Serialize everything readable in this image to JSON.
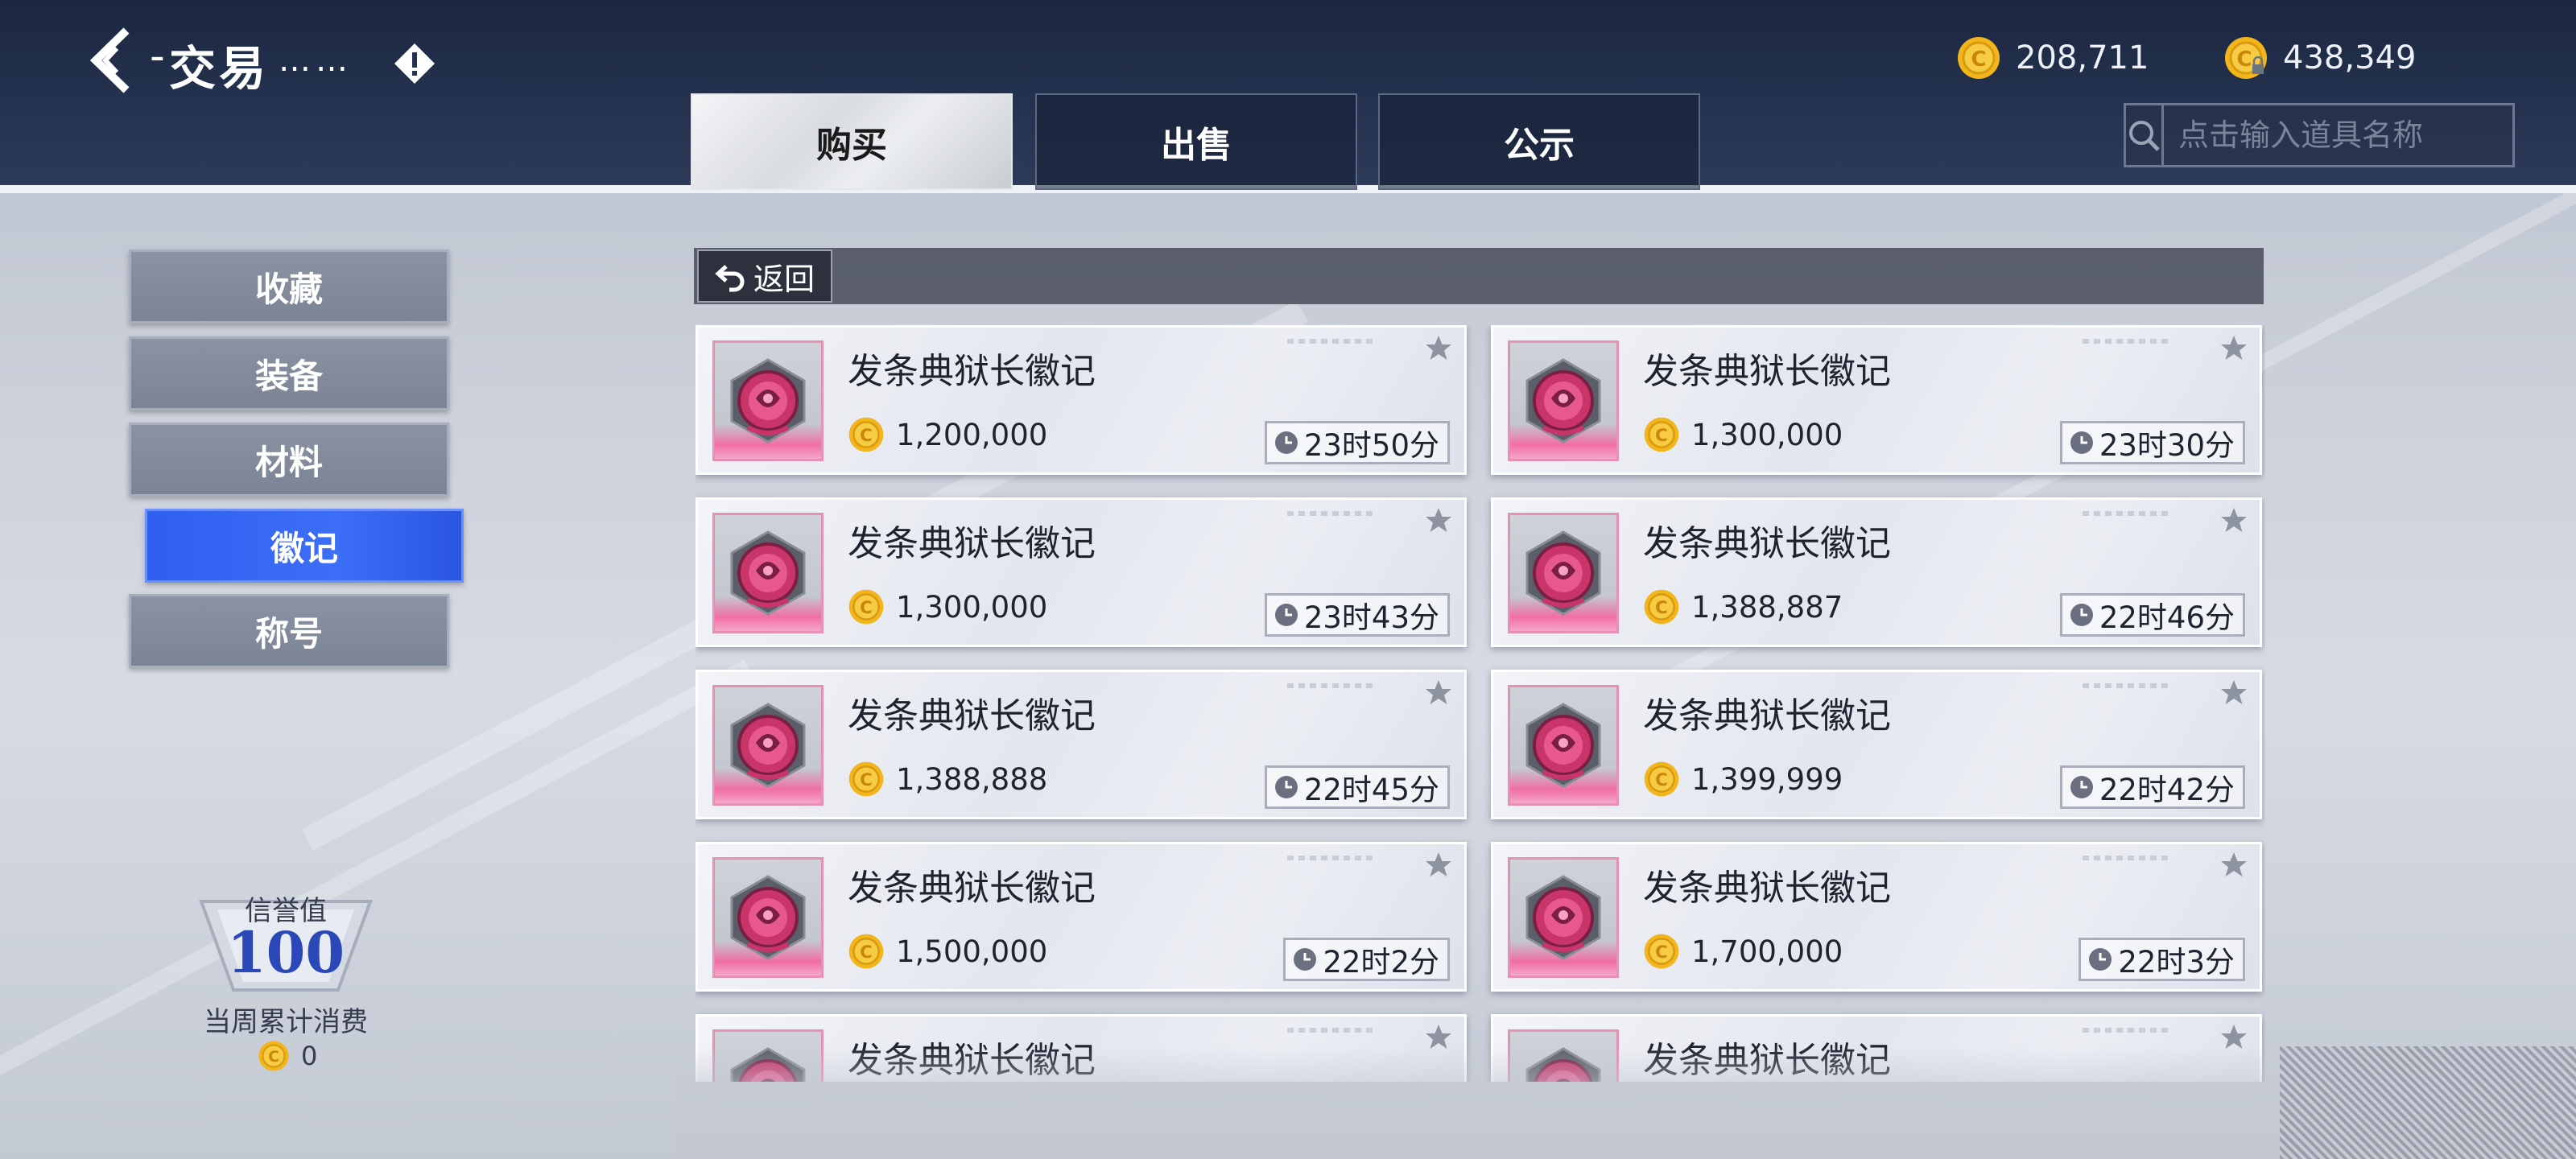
{
  "header": {
    "title": "交易",
    "title_dots": "……",
    "currencies": [
      {
        "icon": "gold-coin-icon",
        "value": "208,711"
      },
      {
        "icon": "locked-gold-coin-icon",
        "value": "438,349"
      }
    ],
    "tabs": [
      {
        "label": "购买",
        "active": true
      },
      {
        "label": "出售",
        "active": false
      },
      {
        "label": "公示",
        "active": false
      }
    ],
    "search": {
      "placeholder": "点击输入道具名称",
      "value": ""
    }
  },
  "sidebar": {
    "categories": [
      {
        "label": "收藏",
        "active": false
      },
      {
        "label": "装备",
        "active": false
      },
      {
        "label": "材料",
        "active": false
      },
      {
        "label": "徽记",
        "active": true
      },
      {
        "label": "称号",
        "active": false
      }
    ],
    "reputation": {
      "label": "信誉值",
      "value": "100"
    },
    "weekly_spend": {
      "label": "当周累计消费",
      "value": "0"
    }
  },
  "listing": {
    "return_label": "返回",
    "items": [
      {
        "name": "发条典狱长徽记",
        "price": "1,200,000",
        "time": "23时50分"
      },
      {
        "name": "发条典狱长徽记",
        "price": "1,300,000",
        "time": "23时30分"
      },
      {
        "name": "发条典狱长徽记",
        "price": "1,300,000",
        "time": "23时43分"
      },
      {
        "name": "发条典狱长徽记",
        "price": "1,388,887",
        "time": "22时46分"
      },
      {
        "name": "发条典狱长徽记",
        "price": "1,388,888",
        "time": "22时45分"
      },
      {
        "name": "发条典狱长徽记",
        "price": "1,399,999",
        "time": "22时42分"
      },
      {
        "name": "发条典狱长徽记",
        "price": "1,500,000",
        "time": "22时2分"
      },
      {
        "name": "发条典狱长徽记",
        "price": "1,700,000",
        "time": "22时3分"
      },
      {
        "name": "发条典狱长徽记",
        "price": "",
        "time": ""
      },
      {
        "name": "发条典狱长徽记",
        "price": "",
        "time": ""
      }
    ]
  },
  "colors": {
    "accent_blue": "#3d6ef7",
    "topbar": "#24324f",
    "coin_gold": "#f2b51c",
    "emblem_pink": "#f06ea6"
  }
}
